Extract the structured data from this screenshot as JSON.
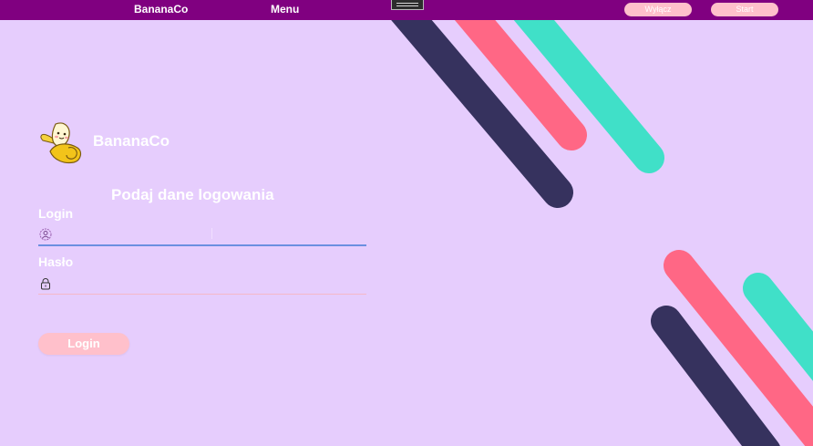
{
  "topbar": {
    "brand": "BananaCo",
    "menu": "Menu",
    "shutdown_label": "Wyłącz",
    "start_label": "Start"
  },
  "header": {
    "brand": "BananaCo"
  },
  "form": {
    "title": "Podaj dane logowania",
    "login_label": "Login",
    "login_value": "",
    "password_label": "Hasło",
    "password_value": "",
    "submit_label": "Login"
  },
  "icons": {
    "logo": "banana-mascot-icon",
    "login_field": "user-icon",
    "password_field": "lock-icon",
    "menu_toggle": "hamburger-icon"
  },
  "colors": {
    "background": "#e6cdfd",
    "topbar": "#800080",
    "button_pink": "#ffc0cb",
    "stripe_navy": "#36325e",
    "stripe_coral": "#ff6785",
    "stripe_teal": "#40e0c8"
  }
}
